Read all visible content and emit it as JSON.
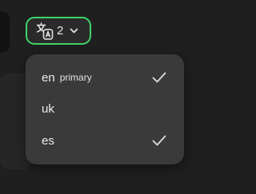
{
  "language_button": {
    "count": "2",
    "icon": "translate-icon",
    "caret_icon": "chevron-down-icon",
    "accent_color": "#3ed466"
  },
  "language_menu": {
    "items": [
      {
        "code": "en",
        "tag": "primary",
        "checked": true
      },
      {
        "code": "uk",
        "tag": "",
        "checked": false
      },
      {
        "code": "es",
        "tag": "",
        "checked": true
      }
    ]
  }
}
